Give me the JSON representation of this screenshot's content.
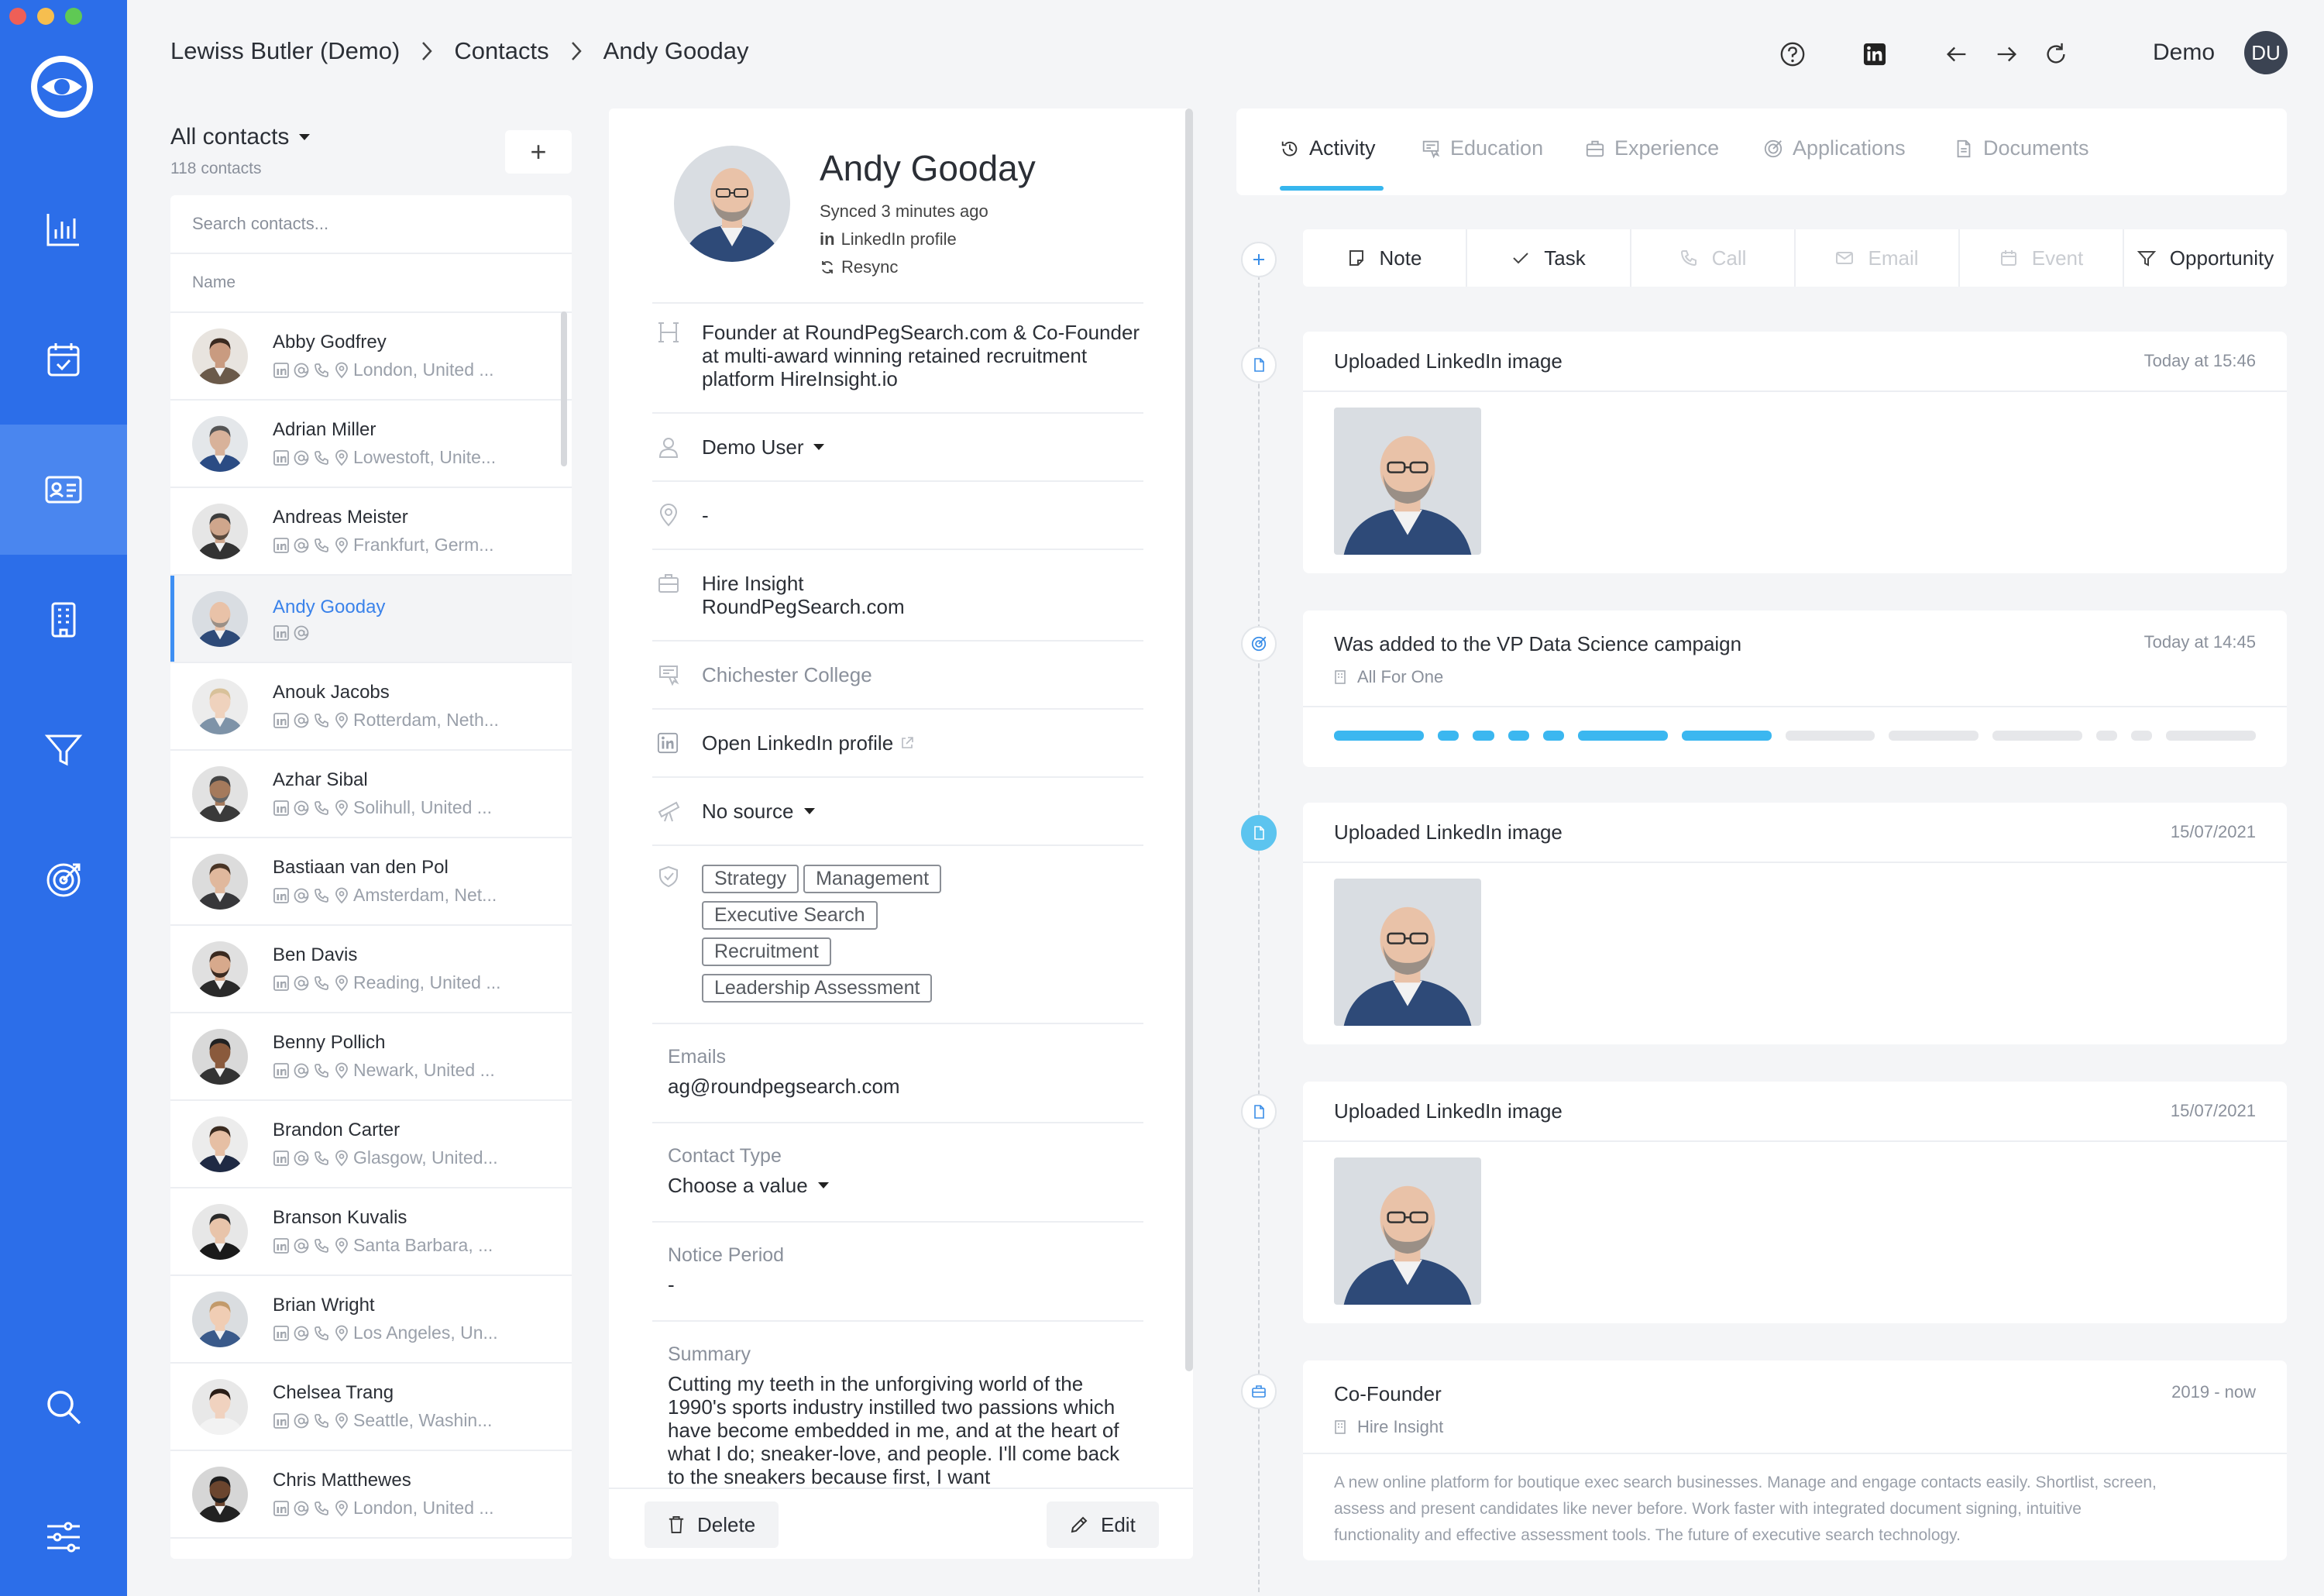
{
  "breadcrumb": [
    "Lewiss Butler (Demo)",
    "Contacts",
    "Andy Gooday"
  ],
  "user": {
    "name": "Demo",
    "initials": "DU"
  },
  "colors": {
    "rail": "#2c6ee9",
    "accent": "#36b6ee",
    "link": "#3a82ea"
  },
  "rail_icons": [
    "eye-logo-icon",
    "chart-icon",
    "calendar-icon",
    "contact-card-icon",
    "building-icon",
    "funnel-icon",
    "target-icon",
    "search-icon",
    "sliders-icon"
  ],
  "contacts": {
    "title": "All contacts",
    "count": "118 contacts",
    "add_label": "+",
    "search_placeholder": "Search contacts...",
    "col_name": "Name",
    "items": [
      {
        "name": "Abby Godfrey",
        "loc": "London, United ..."
      },
      {
        "name": "Adrian Miller",
        "loc": "Lowestoft, Unite..."
      },
      {
        "name": "Andreas Meister",
        "loc": "Frankfurt, Germ..."
      },
      {
        "name": "Andy Gooday",
        "loc": ""
      },
      {
        "name": "Anouk Jacobs",
        "loc": "Rotterdam, Neth..."
      },
      {
        "name": "Azhar Sibal",
        "loc": "Solihull, United ..."
      },
      {
        "name": "Bastiaan van den Pol",
        "loc": "Amsterdam, Net..."
      },
      {
        "name": "Ben Davis",
        "loc": "Reading, United ..."
      },
      {
        "name": "Benny Pollich",
        "loc": "Newark, United ..."
      },
      {
        "name": "Brandon Carter",
        "loc": "Glasgow, United..."
      },
      {
        "name": "Branson Kuvalis",
        "loc": "Santa Barbara, ..."
      },
      {
        "name": "Brian Wright",
        "loc": "Los Angeles, Un..."
      },
      {
        "name": "Chelsea Trang",
        "loc": "Seattle, Washin..."
      },
      {
        "name": "Chris Matthewes",
        "loc": "London, United ..."
      }
    ]
  },
  "profile": {
    "name": "Andy Gooday",
    "synced": "Synced 3 minutes ago",
    "linkedin_label": "LinkedIn profile",
    "linkedin_in": "in",
    "resync": "Resync",
    "headline": "Founder at RoundPegSearch.com & Co-Founder at multi-award winning retained recruitment platform HireInsight.io",
    "owner": "Demo User",
    "location": "-",
    "company_1": "Hire Insight",
    "company_2": "RoundPegSearch.com",
    "education": "Chichester College",
    "linkedin_link": "Open LinkedIn profile",
    "source": "No source",
    "tags": [
      "Strategy",
      "Management",
      "Executive Search",
      "Recruitment",
      "Leadership Assessment"
    ],
    "emails_label": "Emails",
    "email": "ag@roundpegsearch.com",
    "contact_type_label": "Contact Type",
    "contact_type_value": "Choose a value",
    "notice_label": "Notice Period",
    "notice_value": "-",
    "summary_label": "Summary",
    "summary": "Cutting my teeth in the unforgiving world of the 1990's sports industry instilled two passions which have become embedded in me, and at the heart of what I do; sneaker-love, and people. I'll come back to the sneakers because first, I want",
    "delete_label": "Delete",
    "edit_label": "Edit"
  },
  "tabs": [
    {
      "label": "Activity",
      "icon": "history-icon"
    },
    {
      "label": "Education",
      "icon": "certificate-icon"
    },
    {
      "label": "Experience",
      "icon": "briefcase-icon"
    },
    {
      "label": "Applications",
      "icon": "target-icon"
    },
    {
      "label": "Documents",
      "icon": "document-icon"
    }
  ],
  "actions": [
    {
      "label": "Note",
      "icon": "note-icon",
      "enabled": true
    },
    {
      "label": "Task",
      "icon": "check-icon",
      "enabled": true
    },
    {
      "label": "Call",
      "icon": "phone-icon",
      "enabled": false
    },
    {
      "label": "Email",
      "icon": "mail-icon",
      "enabled": false
    },
    {
      "label": "Event",
      "icon": "calendar-icon",
      "enabled": false
    },
    {
      "label": "Opportunity",
      "icon": "funnel-icon",
      "enabled": true
    }
  ],
  "activities": [
    {
      "title": "Uploaded LinkedIn image",
      "time": "Today at 15:46"
    },
    {
      "title": "Was added to the VP Data Science campaign",
      "time": "Today at 14:45",
      "sub": "All For One",
      "progress_done": 7,
      "progress_total": 13
    },
    {
      "title": "Uploaded LinkedIn image",
      "time": "15/07/2021"
    },
    {
      "title": "Uploaded LinkedIn image",
      "time": "15/07/2021"
    },
    {
      "title": "Co-Founder",
      "time": "2019 - now",
      "sub": "Hire Insight",
      "desc": "A new online platform for boutique exec search businesses. Manage and engage contacts easily. Shortlist, screen, assess and present candidates like never before. Work faster with integrated document signing, intuitive functionality and effective assessment tools. The future of executive search technology."
    }
  ]
}
